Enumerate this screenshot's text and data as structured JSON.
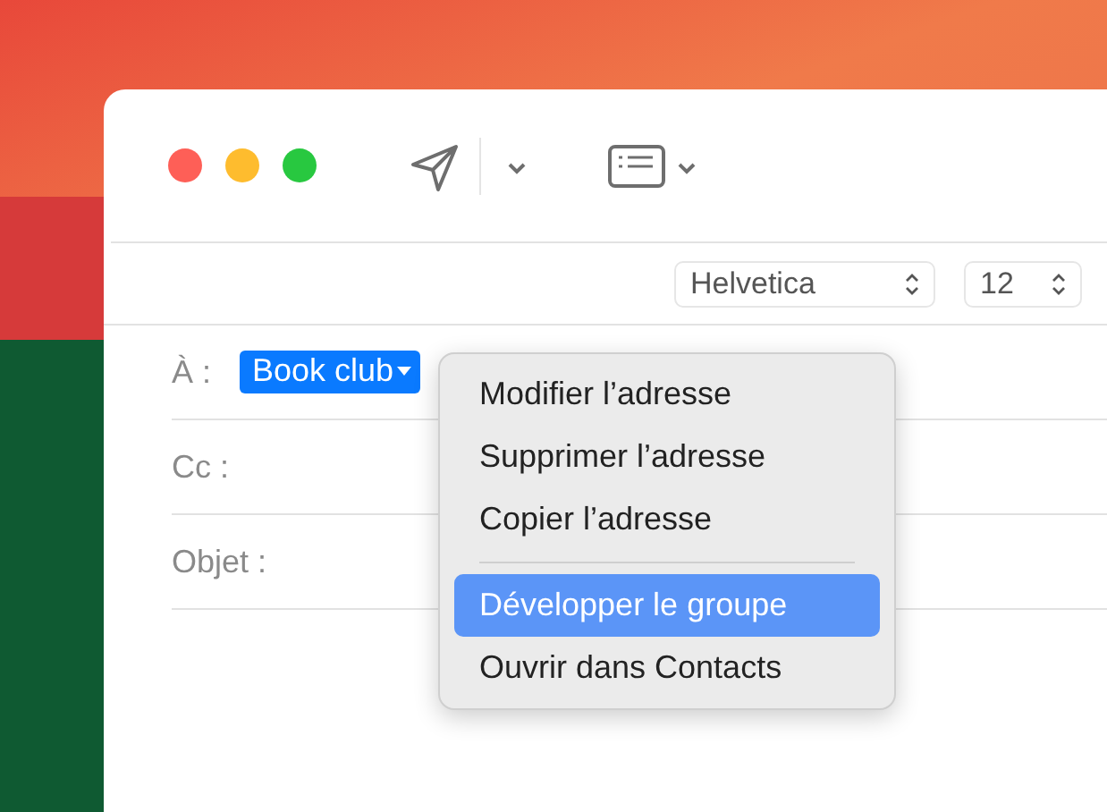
{
  "toolbar": {
    "font": {
      "value": "Helvetica"
    },
    "size": {
      "value": "12"
    }
  },
  "fields": [
    {
      "label": "À :",
      "tokens": [
        {
          "text": "Book club",
          "selected": true
        }
      ]
    },
    {
      "label": "Cc :"
    },
    {
      "label": "Objet :"
    }
  ],
  "context_menu": {
    "items": [
      {
        "kind": "item",
        "label": "Modifier l’adresse",
        "selected": false
      },
      {
        "kind": "item",
        "label": "Supprimer l’adresse",
        "selected": false
      },
      {
        "kind": "item",
        "label": "Copier l’adresse",
        "selected": false
      },
      {
        "kind": "separator"
      },
      {
        "kind": "item",
        "label": "Développer le groupe",
        "selected": true
      },
      {
        "kind": "item",
        "label": "Ouvrir dans Contacts",
        "selected": false
      }
    ]
  }
}
